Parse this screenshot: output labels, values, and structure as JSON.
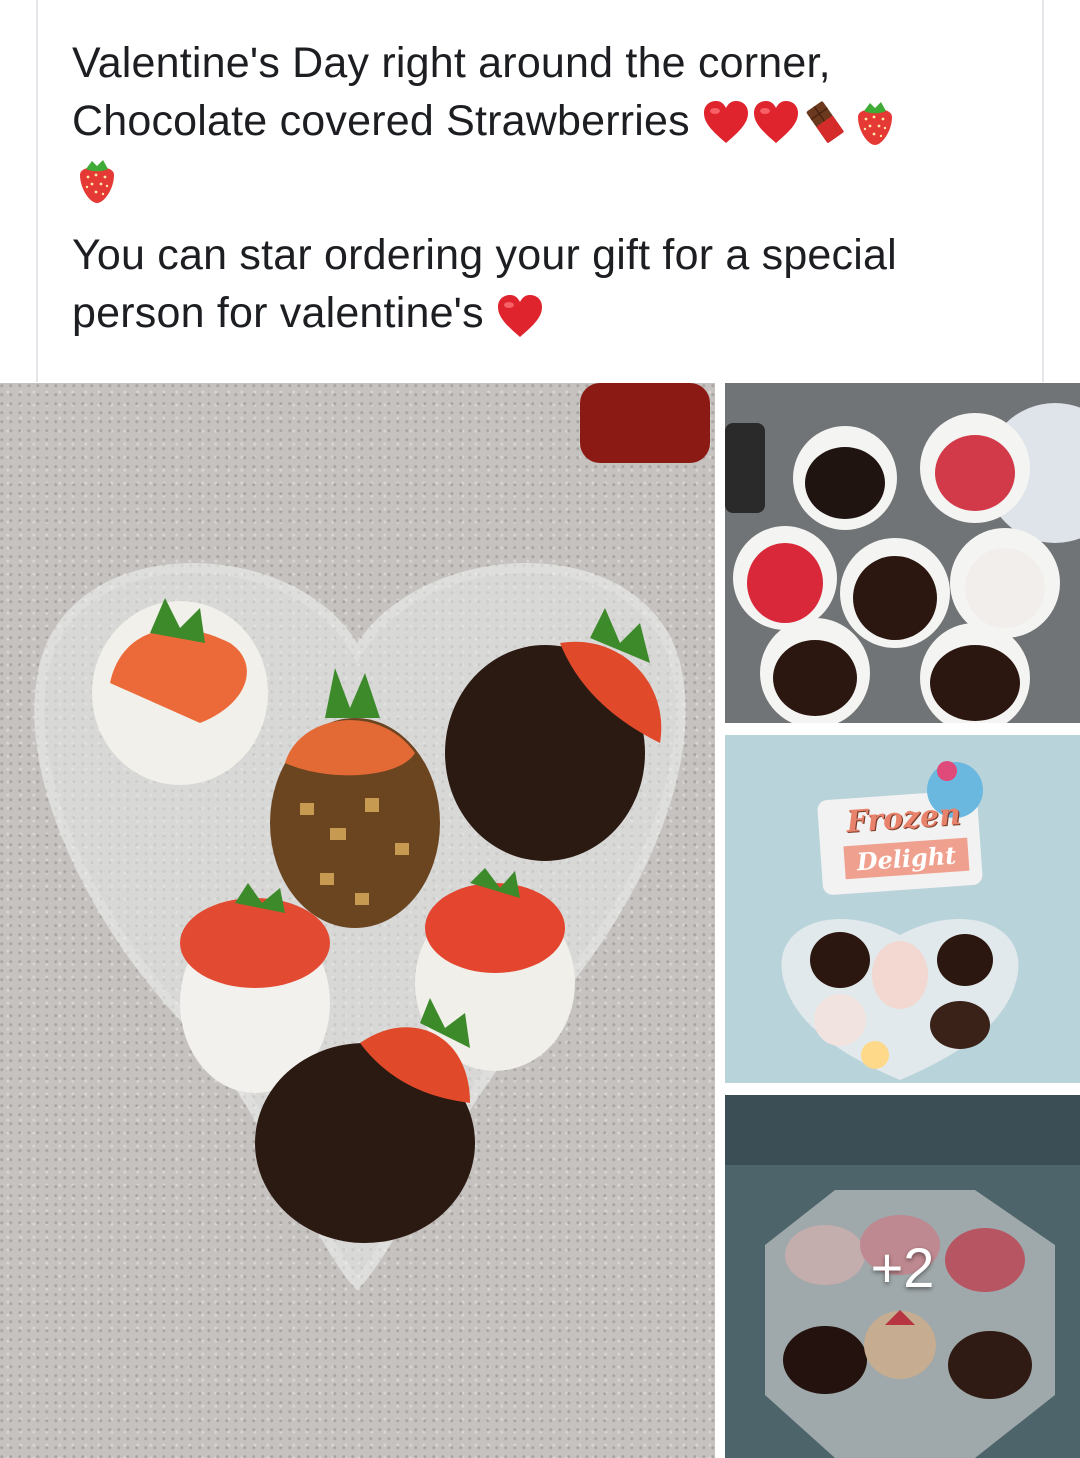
{
  "post": {
    "line1": "Valentine's Day right around the corner,",
    "line2": "Chocolate covered Strawberries",
    "line3": "You can star ordering your gift for a special",
    "line4": "person for valentine's",
    "line2_emojis": [
      "heart-icon",
      "heart-icon",
      "chocolate-bar-icon",
      "strawberry-icon",
      "strawberry-icon"
    ],
    "line4_emojis": [
      "heart-icon"
    ]
  },
  "gallery": {
    "more_count": "+2",
    "store_sign_line1": "Frozen",
    "store_sign_line2": "Delight"
  },
  "colors": {
    "text": "#1c1e21",
    "heart": "#e0242e",
    "strawberry": "#e53935",
    "divider": "#e4e6ea"
  }
}
